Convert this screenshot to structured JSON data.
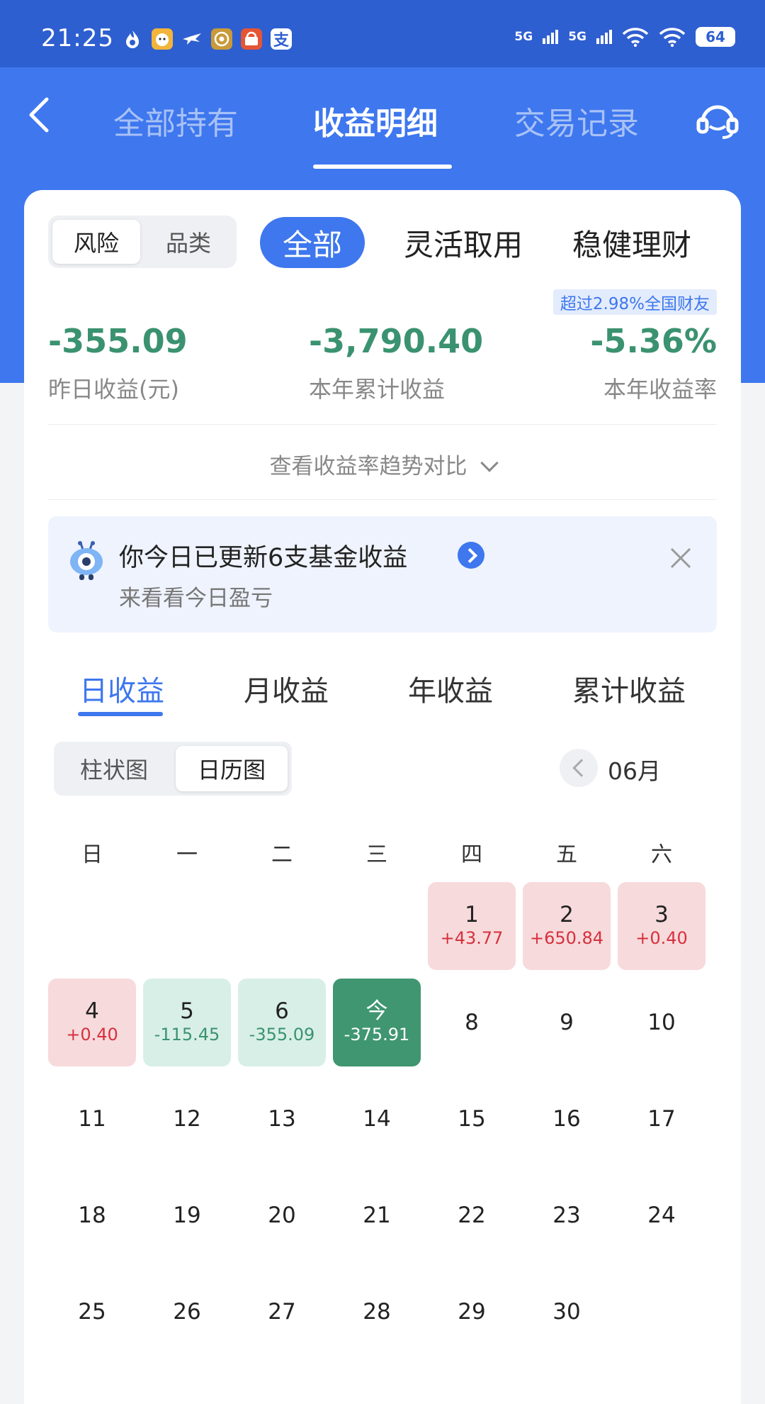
{
  "status_bar": {
    "time": "21:25",
    "network_1": "5G",
    "network_2": "5G",
    "battery": "64"
  },
  "nav": {
    "tabs": [
      {
        "label": "全部持有"
      },
      {
        "label": "收益明细"
      },
      {
        "label": "交易记录"
      }
    ],
    "active_tab": 1
  },
  "filter": {
    "segment": [
      "风险",
      "品类"
    ],
    "segment_selected": "风险",
    "categories": [
      "全部",
      "灵活取用",
      "稳健理财"
    ],
    "category_selected": "全部"
  },
  "rank_badge": "超过2.98%全国财友",
  "stats": [
    {
      "value": "-355.09",
      "label": "昨日收益(元)"
    },
    {
      "value": "-3,790.40",
      "label": "本年累计收益"
    },
    {
      "value": "-5.36%",
      "label": "本年收益率"
    }
  ],
  "trend_link": "查看收益率趋势对比",
  "notice": {
    "title": "你今日已更新6支基金收益",
    "subtitle": "来看看今日盈亏"
  },
  "period_tabs": [
    "日收益",
    "月收益",
    "年收益",
    "累计收益"
  ],
  "period_selected": "日收益",
  "view_toggle": [
    "柱状图",
    "日历图"
  ],
  "view_selected": "日历图",
  "month": "06月",
  "weekdays": [
    "日",
    "一",
    "二",
    "三",
    "四",
    "五",
    "六"
  ],
  "calendar": [
    {
      "day": "1",
      "value": "+43.77",
      "status": "up"
    },
    {
      "day": "2",
      "value": "+650.84",
      "status": "up"
    },
    {
      "day": "3",
      "value": "+0.40",
      "status": "up"
    },
    {
      "day": "4",
      "value": "+0.40",
      "status": "up"
    },
    {
      "day": "5",
      "value": "-115.45",
      "status": "down"
    },
    {
      "day": "6",
      "value": "-355.09",
      "status": "down"
    },
    {
      "day": "今",
      "value": "-375.91",
      "status": "today"
    },
    {
      "day": "8"
    },
    {
      "day": "9"
    },
    {
      "day": "10"
    },
    {
      "day": "11"
    },
    {
      "day": "12"
    },
    {
      "day": "13"
    },
    {
      "day": "14"
    },
    {
      "day": "15"
    },
    {
      "day": "16"
    },
    {
      "day": "17"
    },
    {
      "day": "18"
    },
    {
      "day": "19"
    },
    {
      "day": "20"
    },
    {
      "day": "21"
    },
    {
      "day": "22"
    },
    {
      "day": "23"
    },
    {
      "day": "24"
    },
    {
      "day": "25"
    },
    {
      "day": "26"
    },
    {
      "day": "27"
    },
    {
      "day": "28"
    },
    {
      "day": "29"
    },
    {
      "day": "30"
    }
  ],
  "colors": {
    "brand_blue": "#3e77ee",
    "gain_red": "#d6313e",
    "loss_green": "#3a9270"
  }
}
